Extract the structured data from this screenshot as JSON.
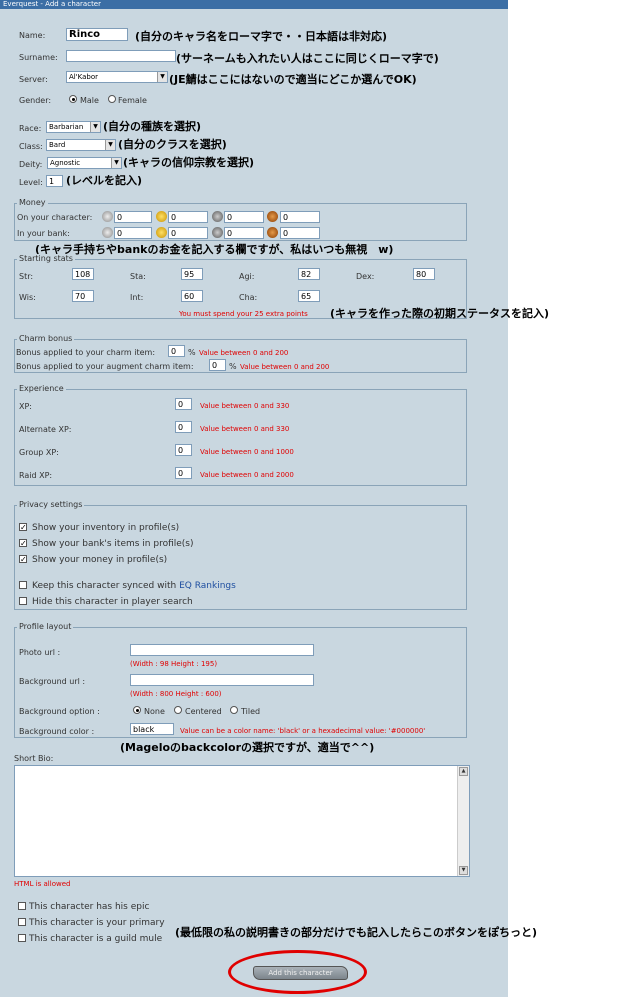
{
  "window_title": "Everquest - Add a character",
  "character": {
    "name_label": "Name:",
    "name_value": "Rinco",
    "name_note": "(自分のキャラ名をローマ字で・・日本語は非対応)",
    "surname_label": "Surname:",
    "surname_value": "",
    "surname_note": "(サーネームも入れたい人はここに同じくローマ字で)",
    "server_label": "Server:",
    "server_value": "Al'Kabor",
    "server_note": "(JE鯖はここにはないので適当にどこか選んでOK)",
    "gender_label": "Gender:",
    "gender_male": "Male",
    "gender_female": "Female",
    "race_label": "Race:",
    "race_value": "Barbarian",
    "race_note": "(自分の種族を選択)",
    "class_label": "Class:",
    "class_value": "Bard",
    "class_note": "(自分のクラスを選択)",
    "deity_label": "Deity:",
    "deity_value": "Agnostic",
    "deity_note": "(キャラの信仰宗教を選択)",
    "level_label": "Level:",
    "level_value": "1",
    "level_note": "(レベルを記入)"
  },
  "money": {
    "legend": "Money",
    "on_char_label": "On your character:",
    "in_bank_label": "In your bank:",
    "on_char": [
      "0",
      "0",
      "0",
      "0"
    ],
    "in_bank": [
      "0",
      "0",
      "0",
      "0"
    ],
    "note": "(キャラ手持ちやbankのお金を記入する欄ですが、私はいつも無視　w)"
  },
  "stats": {
    "legend": "Starting stats",
    "str_label": "Str:",
    "str": "108",
    "sta_label": "Sta:",
    "sta": "95",
    "agi_label": "Agi:",
    "agi": "82",
    "dex_label": "Dex:",
    "dex": "80",
    "wis_label": "Wis:",
    "wis": "70",
    "int_label": "Int:",
    "int": "60",
    "cha_label": "Cha:",
    "cha": "65",
    "warning": "You must spend your 25 extra points",
    "note": "(キャラを作った際の初期ステータスを記入)"
  },
  "charm": {
    "legend": "Charm bonus",
    "item_label": "Bonus applied to your charm item:",
    "item_value": "0",
    "item_hint": "Value between 0 and 200",
    "augment_label": "Bonus applied to your augment charm item:",
    "augment_value": "0",
    "augment_hint": "Value between 0 and 200",
    "percent": "%"
  },
  "experience": {
    "legend": "Experience",
    "xp_label": "XP:",
    "xp_value": "0",
    "xp_hint": "Value between 0 and 330",
    "alt_label": "Alternate XP:",
    "alt_value": "0",
    "alt_hint": "Value between 0 and 330",
    "group_label": "Group XP:",
    "group_value": "0",
    "group_hint": "Value between 0 and 1000",
    "raid_label": "Raid XP:",
    "raid_value": "0",
    "raid_hint": "Value between 0 and 2000"
  },
  "privacy": {
    "legend": "Privacy settings",
    "inventory": "Show your inventory in profile(s)",
    "bank": "Show your bank's items in profile(s)",
    "money": "Show your money in profile(s)",
    "sync_prefix": "Keep this character synced with ",
    "sync_link": "EQ Rankings",
    "hide": "Hide this character in player search"
  },
  "profile": {
    "legend": "Profile layout",
    "photo_label": "Photo url :",
    "photo_value": "",
    "photo_hint": "(Width : 98   Height : 195)",
    "bg_label": "Background url :",
    "bg_value": "",
    "bg_hint": "(Width : 800   Height : 600)",
    "option_label": "Background option :",
    "opt_none": "None",
    "opt_centered": "Centered",
    "opt_tiled": "Tiled",
    "color_label": "Background color :",
    "color_value": "black",
    "color_hint": "Value can be a color name: 'black' or a hexadecimal value: '#000000'",
    "note": "(Mageloのbackcolorの選択ですが、適当で^^)"
  },
  "bio": {
    "label": "Short Bio:",
    "html_note": "HTML is allowed"
  },
  "flags": {
    "epic": "This character has his epic",
    "primary": "This character is your primary",
    "mule": "This character is a guild mule",
    "note": "(最低限の私の説明書きの部分だけでも記入したらこのボタンをぽちっと)"
  },
  "submit_label": "Add this character",
  "colors": {
    "panel": "#c9d7e0",
    "titlebar": "#3b6ea5",
    "hint_red": "#e00000",
    "highlight_ellipse": "#e00000"
  }
}
